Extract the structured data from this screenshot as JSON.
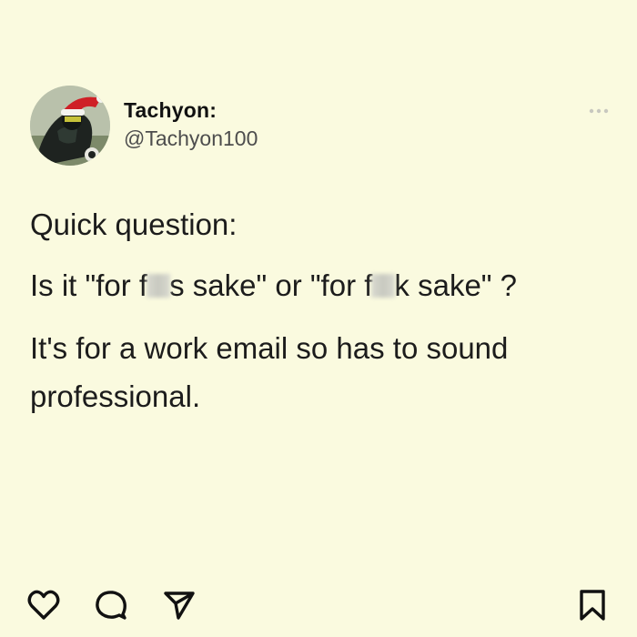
{
  "post": {
    "author": {
      "display_name": "Tachyon:",
      "handle": "@Tachyon100"
    },
    "body": {
      "line1": "Quick question:",
      "line2_part1": "Is it \"for f",
      "line2_part2": "s sake\" or \"for f",
      "line2_part3": "k sake\" ?",
      "line3": "It's for a work email so has to sound professional."
    }
  },
  "actions": {
    "icons": [
      "heart-icon",
      "comment-icon",
      "send-icon",
      "bookmark-icon"
    ]
  },
  "colors": {
    "background": "#fafadf",
    "text": "#1c1c1c",
    "handle": "#4d4d4d",
    "more_dots": "#c8c8bf"
  }
}
